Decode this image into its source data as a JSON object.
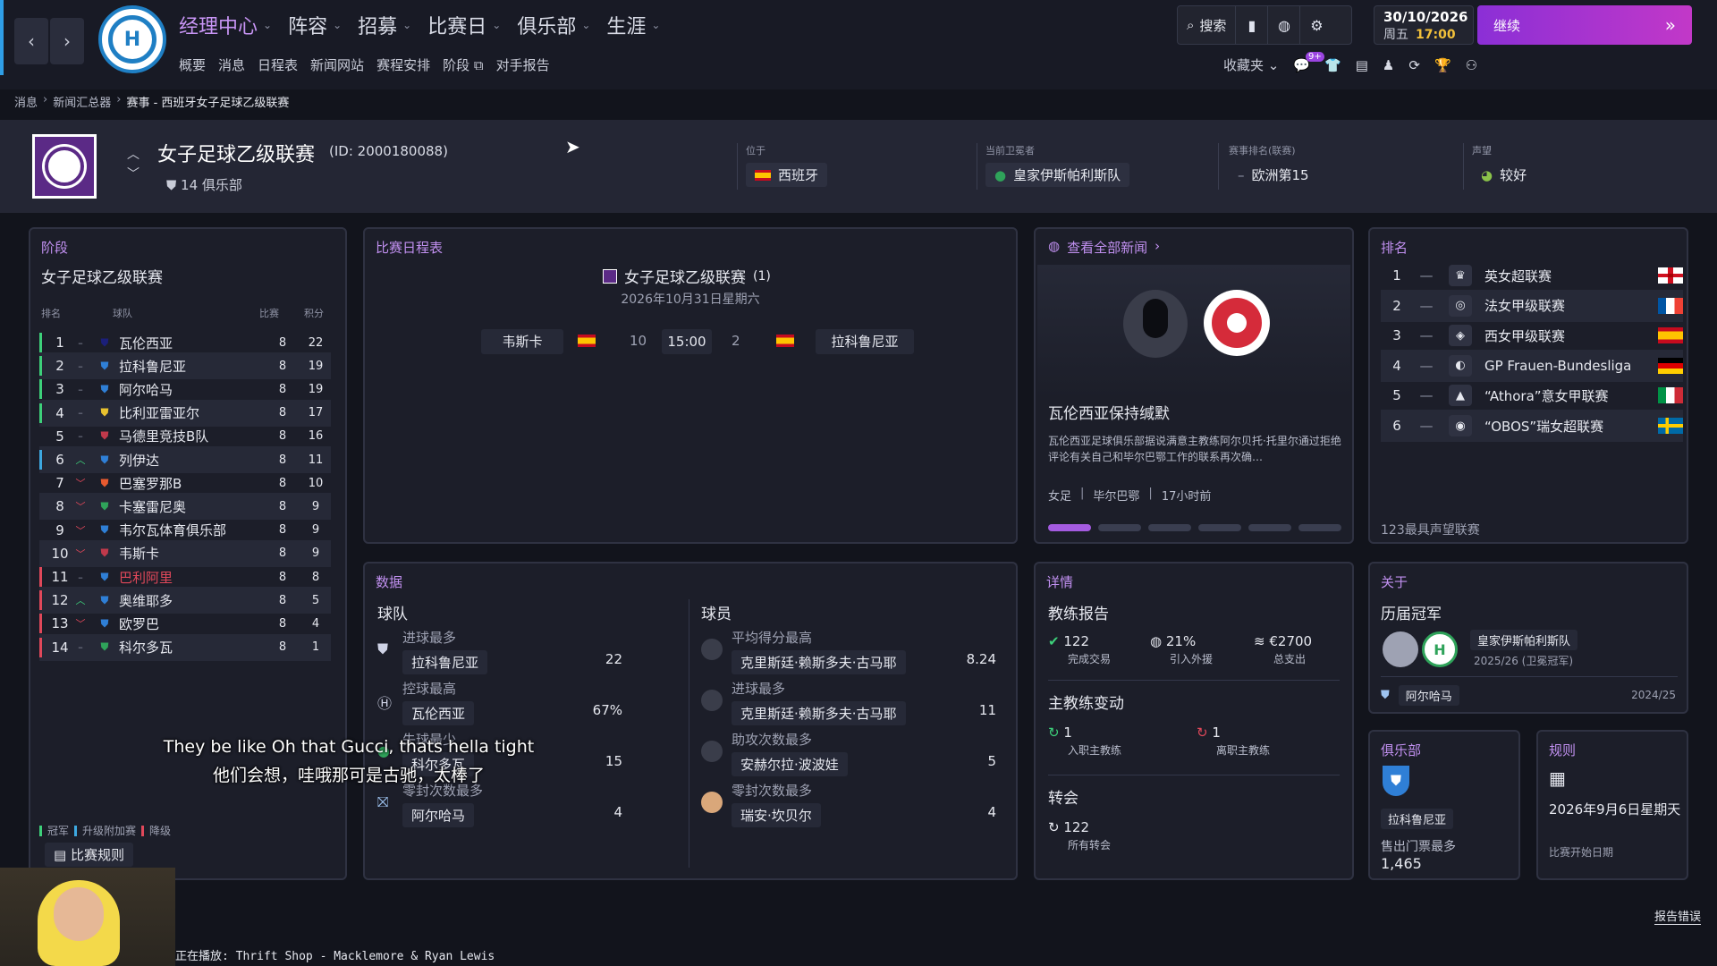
{
  "topbar": {
    "main_menu": [
      {
        "label": "经理中心",
        "active": true
      },
      {
        "label": "阵容"
      },
      {
        "label": "招募"
      },
      {
        "label": "比赛日"
      },
      {
        "label": "俱乐部"
      },
      {
        "label": "生涯"
      }
    ],
    "sub_menu": [
      "概要",
      "消息",
      "日程表",
      "新闻网站",
      "赛程安排",
      "阶段",
      "对手报告"
    ],
    "search_label": "搜索",
    "date": "30/10/2026",
    "weekday": "周五",
    "time": "17:00",
    "continue_label": "继续",
    "favorites_label": "收藏夹",
    "notification_count": "9+"
  },
  "breadcrumb": [
    "消息",
    "新闻汇总器",
    "赛事 - 西班牙女子足球乙级联赛"
  ],
  "header": {
    "title": "女子足球乙级联赛",
    "id_text": "(ID: 2000180088)",
    "clubs": "14 俱乐部",
    "location_label": "位于",
    "location_value": "西班牙",
    "holder_label": "当前卫冕者",
    "holder_value": "皇家伊斯帕利斯队",
    "rank_label": "赛事排名(联赛)",
    "rank_value": "欧洲第15",
    "reputation_label": "声望",
    "reputation_value": "较好"
  },
  "standings": {
    "panel_title": "阶段",
    "league_name": "女子足球乙级联赛",
    "col_pos": "排名",
    "col_team": "球队",
    "col_played": "比赛",
    "col_points": "积分",
    "rows": [
      {
        "pos": "1",
        "team": "瓦伦西亚",
        "played": "8",
        "points": "22",
        "move": "–"
      },
      {
        "pos": "2",
        "team": "拉科鲁尼亚",
        "played": "8",
        "points": "19",
        "move": "–"
      },
      {
        "pos": "3",
        "team": "阿尔哈马",
        "played": "8",
        "points": "19",
        "move": "–"
      },
      {
        "pos": "4",
        "team": "比利亚雷亚尔",
        "played": "8",
        "points": "17",
        "move": "–"
      },
      {
        "pos": "5",
        "team": "马德里竞技B队",
        "played": "8",
        "points": "16",
        "move": "–"
      },
      {
        "pos": "6",
        "team": "列伊达",
        "played": "8",
        "points": "11",
        "move": "^"
      },
      {
        "pos": "7",
        "team": "巴塞罗那B",
        "played": "8",
        "points": "10",
        "move": "v"
      },
      {
        "pos": "8",
        "team": "卡塞雷尼奥",
        "played": "8",
        "points": "9",
        "move": "v"
      },
      {
        "pos": "9",
        "team": "韦尔瓦体育俱乐部",
        "played": "8",
        "points": "9",
        "move": "v"
      },
      {
        "pos": "10",
        "team": "韦斯卡",
        "played": "8",
        "points": "9",
        "move": "v"
      },
      {
        "pos": "11",
        "team": "巴利阿里",
        "played": "8",
        "points": "8",
        "move": "–"
      },
      {
        "pos": "12",
        "team": "奥维耶多",
        "played": "8",
        "points": "5",
        "move": "^"
      },
      {
        "pos": "13",
        "team": "欧罗巴",
        "played": "8",
        "points": "4",
        "move": "v"
      },
      {
        "pos": "14",
        "team": "科尔多瓦",
        "played": "8",
        "points": "1",
        "move": "–"
      }
    ],
    "legend": [
      "冠军",
      "升级附加赛",
      "降级"
    ],
    "rules_button": "比赛规则"
  },
  "fixtures": {
    "panel_title": "比赛日程表",
    "competition": "女子足球乙级联赛",
    "round": "(1)",
    "date": "2026年10月31日星期六",
    "home": "韦斯卡",
    "home_pos": "10",
    "time": "15:00",
    "away_pos": "2",
    "away": "拉科鲁尼亚"
  },
  "news": {
    "link": "查看全部新闻",
    "headline": "瓦伦西亚保持缄默",
    "body": "瓦伦西亚足球俱乐部据说满意主教练阿尔贝托·托里尔通过拒绝评论有关自己和毕尔巴鄂工作的联系再次确…",
    "tag1": "女足",
    "tag2": "毕尔巴鄂",
    "time_ago": "17小时前"
  },
  "ranking": {
    "panel_title": "排名",
    "rows": [
      {
        "n": "1",
        "name": "英女超联赛"
      },
      {
        "n": "2",
        "name": "法女甲级联赛"
      },
      {
        "n": "3",
        "name": "西女甲级联赛"
      },
      {
        "n": "4",
        "name": "GP Frauen-Bundesliga"
      },
      {
        "n": "5",
        "name": "“Athora”意女甲联赛"
      },
      {
        "n": "6",
        "name": "“OBOS”瑞女超联赛"
      }
    ],
    "footer": "123最具声望联赛"
  },
  "data": {
    "panel_title": "数据",
    "team_heading": "球队",
    "player_heading": "球员",
    "team_stats": [
      {
        "title": "进球最多",
        "value": "拉科鲁尼亚",
        "num": "22"
      },
      {
        "title": "控球最高",
        "value": "瓦伦西亚",
        "num": "67%"
      },
      {
        "title": "失球最少",
        "value": "科尔多瓦",
        "num": "15"
      },
      {
        "title": "零封次数最多",
        "value": "阿尔哈马",
        "num": "4"
      }
    ],
    "player_stats": [
      {
        "title": "平均得分最高",
        "value": "克里斯廷·赖斯多夫·古马耶",
        "num": "8.24"
      },
      {
        "title": "进球最多",
        "value": "克里斯廷·赖斯多夫·古马耶",
        "num": "11"
      },
      {
        "title": "助攻次数最多",
        "value": "安赫尔拉·波波娃",
        "num": "5"
      },
      {
        "title": "零封次数最多",
        "value": "瑞安·坎贝尔",
        "num": "4"
      }
    ]
  },
  "details": {
    "panel_title": "详情",
    "coach_report": "教练报告",
    "done_deals": "122",
    "done_deals_label": "完成交易",
    "foreign_pct": "21%",
    "foreign_label": "引入外援",
    "spend": "€2700",
    "spend_label": "总支出",
    "coach_changes": "主教练变动",
    "hired": "1",
    "hired_label": "入职主教练",
    "left": "1",
    "left_label": "离职主教练",
    "transfers": "转会",
    "transfers_count": "122",
    "transfers_label": "所有转会"
  },
  "about": {
    "panel_title": "关于",
    "champions_heading": "历届冠军",
    "champion": "皇家伊斯帕利斯队",
    "champion_season": "2025/26 (卫冕冠军)",
    "runner": "阿尔哈马",
    "runner_season": "2024/25"
  },
  "club": {
    "panel_title": "俱乐部",
    "name": "拉科鲁尼亚",
    "stat_label": "售出门票最多",
    "stat_value": "1,465"
  },
  "rules": {
    "panel_title": "规则",
    "start_date": "2026年9月6日星期天",
    "start_label": "比赛开始日期"
  },
  "report_error": "报告错误",
  "overlay": {
    "subtitle_en": "They be like Oh that Gucci, thats hella tight",
    "subtitle_cn": "他们会想，哇哦那可是古驰，太棒了",
    "now_playing": "正在播放: Thrift Shop - Macklemore & Ryan Lewis"
  }
}
